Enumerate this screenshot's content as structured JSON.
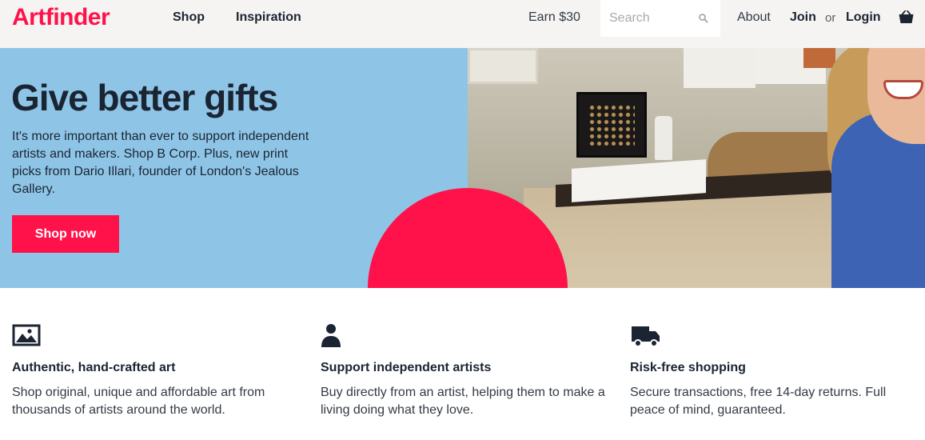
{
  "header": {
    "logo": "Artfinder",
    "nav": {
      "shop": "Shop",
      "inspiration": "Inspiration"
    },
    "earn": "Earn $30",
    "search": {
      "placeholder": "Search",
      "value": ""
    },
    "about": "About",
    "join": "Join",
    "or": "or",
    "login": "Login"
  },
  "hero": {
    "title": "Give better gifts",
    "text": "It's more important than ever to support independent artists and makers. Shop B Corp. Plus, new print picks from Dario Illari, founder of London's Jealous Gallery.",
    "cta": "Shop now"
  },
  "features": [
    {
      "icon": "image-icon",
      "title": "Authentic, hand-crafted art",
      "text": "Shop original, unique and affordable art from thousands of artists around the world."
    },
    {
      "icon": "person-icon",
      "title": "Support independent artists",
      "text": "Buy directly from an artist, helping them to make a living doing what they love."
    },
    {
      "icon": "truck-icon",
      "title": "Risk-free shopping",
      "text": "Secure transactions, free 14-day returns. Full peace of mind, guaranteed."
    }
  ],
  "colors": {
    "brand": "#ff1249",
    "hero_bg": "#8ec5e6",
    "header_bg": "#f5f4f2",
    "text": "#1b2432"
  }
}
